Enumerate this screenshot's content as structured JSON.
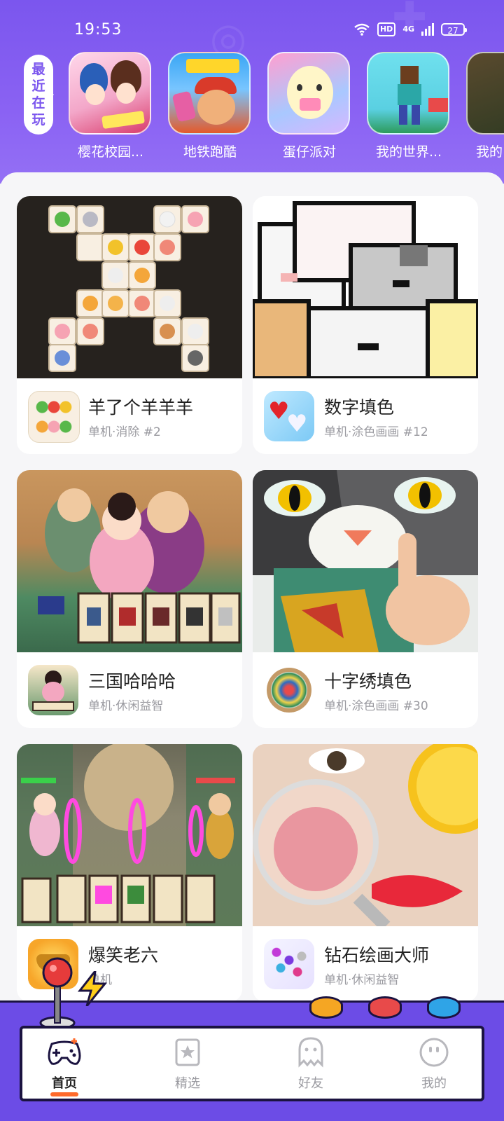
{
  "status_bar": {
    "time": "19:53",
    "hd": "HD",
    "network": "4G",
    "battery": "27"
  },
  "recent": {
    "label": "最近在玩",
    "items": [
      {
        "name": "樱花校园...",
        "icon": "sakura-school-icon"
      },
      {
        "name": "地铁跑酷",
        "icon": "subway-surf-icon"
      },
      {
        "name": "蛋仔派对",
        "icon": "egg-party-icon"
      },
      {
        "name": "我的世界...",
        "icon": "minecraft-icon"
      },
      {
        "name": "我的",
        "icon": "partial-game-icon"
      }
    ]
  },
  "games": [
    {
      "title": "羊了个羊羊羊",
      "subtitle": "单机·消除 #2"
    },
    {
      "title": "数字填色",
      "subtitle": "单机·涂色画画 #12"
    },
    {
      "title": "三国哈哈哈",
      "subtitle": "单机·休闲益智"
    },
    {
      "title": "十字绣填色",
      "subtitle": "单机·涂色画画 #30"
    },
    {
      "title": "爆笑老六",
      "subtitle": "单机"
    },
    {
      "title": "钻石绘画大师",
      "subtitle": "单机·休闲益智"
    }
  ],
  "nav": {
    "items": [
      {
        "label": "首页",
        "icon": "gamepad-icon"
      },
      {
        "label": "精选",
        "icon": "star-bookmark-icon"
      },
      {
        "label": "好友",
        "icon": "ghost-icon"
      },
      {
        "label": "我的",
        "icon": "smiley-face-icon"
      }
    ]
  },
  "colors": {
    "header": "#7b56ee",
    "nav_bar": "#6c4ce6",
    "active_underline": "#ff6a2b",
    "button_yellow": "#f5a623",
    "button_red": "#e84a4a",
    "button_blue": "#2fa4e7"
  }
}
